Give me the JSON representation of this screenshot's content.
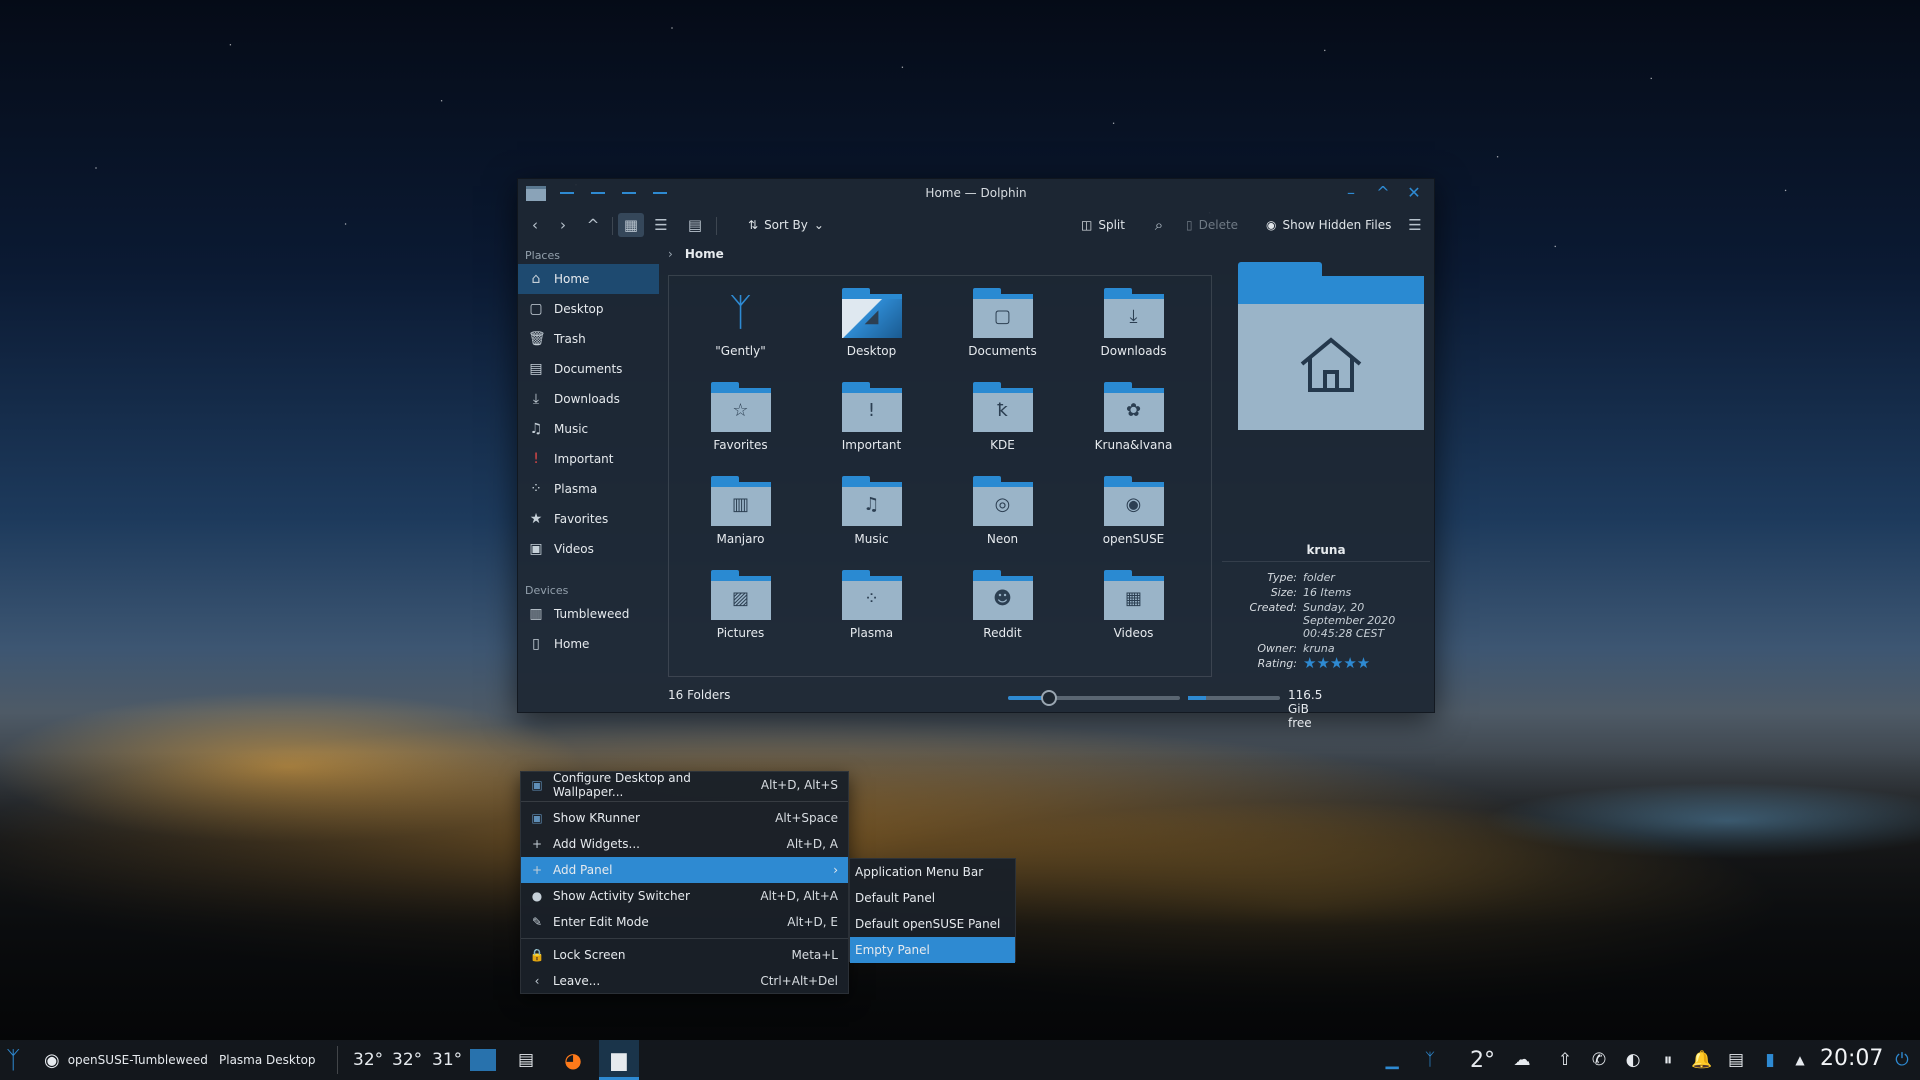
{
  "window": {
    "title": "Home — Dolphin",
    "toolbar": {
      "sort_by": "Sort By",
      "split": "Split",
      "delete": "Delete",
      "show_hidden": "Show Hidden Files"
    },
    "breadcrumb": "Home"
  },
  "places": {
    "places_header": "Places",
    "items": [
      {
        "label": "Home",
        "icon": "home-icon",
        "glyph": "⌂"
      },
      {
        "label": "Desktop",
        "icon": "desktop-icon",
        "glyph": "▢"
      },
      {
        "label": "Trash",
        "icon": "trash-icon",
        "glyph": "🗑"
      },
      {
        "label": "Documents",
        "icon": "documents-icon",
        "glyph": "▤"
      },
      {
        "label": "Downloads",
        "icon": "download-icon",
        "glyph": "⤓"
      },
      {
        "label": "Music",
        "icon": "music-icon",
        "glyph": "♫"
      },
      {
        "label": "Important",
        "icon": "exclamation-icon",
        "glyph": "!"
      },
      {
        "label": "Plasma",
        "icon": "plasma-icon",
        "glyph": "⁘"
      },
      {
        "label": "Favorites",
        "icon": "star-icon",
        "glyph": "★"
      },
      {
        "label": "Videos",
        "icon": "video-icon",
        "glyph": "▣"
      }
    ],
    "devices_header": "Devices",
    "devices": [
      {
        "label": "Tumbleweed",
        "icon": "drive-icon",
        "glyph": "▥"
      },
      {
        "label": "Home",
        "icon": "drive-icon",
        "glyph": "▯"
      }
    ]
  },
  "folders": [
    {
      "label": "\"Gently\"",
      "emblem": "gently-logo-icon",
      "glyph": "ᛉ"
    },
    {
      "label": "Desktop",
      "emblem": "desktop-thumbnail-icon",
      "glyph": "◢"
    },
    {
      "label": "Documents",
      "emblem": "document-icon",
      "glyph": "▢"
    },
    {
      "label": "Downloads",
      "emblem": "download-icon",
      "glyph": "⤓"
    },
    {
      "label": "Favorites",
      "emblem": "star-icon",
      "glyph": "☆"
    },
    {
      "label": "Important",
      "emblem": "exclamation-icon",
      "glyph": "!"
    },
    {
      "label": "KDE",
      "emblem": "kde-icon",
      "glyph": "ꝁ"
    },
    {
      "label": "Kruna&Ivana",
      "emblem": "photo-icon",
      "glyph": "✿"
    },
    {
      "label": "Manjaro",
      "emblem": "manjaro-icon",
      "glyph": "▥"
    },
    {
      "label": "Music",
      "emblem": "music-icon",
      "glyph": "♫"
    },
    {
      "label": "Neon",
      "emblem": "neon-icon",
      "glyph": "◎"
    },
    {
      "label": "openSUSE",
      "emblem": "opensuse-icon",
      "glyph": "◉"
    },
    {
      "label": "Pictures",
      "emblem": "picture-icon",
      "glyph": "▨"
    },
    {
      "label": "Plasma",
      "emblem": "plasma-icon",
      "glyph": "⁘"
    },
    {
      "label": "Reddit",
      "emblem": "reddit-icon",
      "glyph": "☻"
    },
    {
      "label": "Videos",
      "emblem": "film-icon",
      "glyph": "▦"
    }
  ],
  "info": {
    "name": "kruna",
    "type_label": "Type:",
    "type": "folder",
    "size_label": "Size:",
    "size": "16 Items",
    "created_label": "Created:",
    "created": "Sunday, 20 September 2020 00:45:28 CEST",
    "owner_label": "Owner:",
    "owner": "kruna",
    "rating_label": "Rating:",
    "rating": "★★★★★",
    "rating_value": 5
  },
  "status": {
    "count": "16 Folders",
    "free": "116.5 GiB free",
    "zoom_fraction": 0.24,
    "used_fraction": 0.2
  },
  "menu": {
    "items": [
      {
        "label": "Configure Desktop and Wallpaper...",
        "shortcut": "Alt+D, Alt+S",
        "icon": "configure-icon",
        "glyph": "▣"
      },
      {
        "label": "Show KRunner",
        "shortcut": "Alt+Space",
        "icon": "krunner-icon",
        "glyph": "▣"
      },
      {
        "label": "Add Widgets...",
        "shortcut": "Alt+D, A",
        "icon": "plus-icon",
        "glyph": "+"
      },
      {
        "label": "Add Panel",
        "shortcut": "",
        "icon": "plus-icon",
        "glyph": "+"
      },
      {
        "label": "Show Activity Switcher",
        "shortcut": "Alt+D, Alt+A",
        "icon": "activities-icon",
        "glyph": "●"
      },
      {
        "label": "Enter Edit Mode",
        "shortcut": "Alt+D, E",
        "icon": "pencil-icon",
        "glyph": "✎"
      },
      {
        "label": "Lock Screen",
        "shortcut": "Meta+L",
        "icon": "lock-icon",
        "glyph": "🔒"
      },
      {
        "label": "Leave...",
        "shortcut": "Ctrl+Alt+Del",
        "icon": "chevron-left-icon",
        "glyph": "‹"
      }
    ],
    "submenu": [
      "Application Menu Bar",
      "Default Panel",
      "Default openSUSE Panel",
      "Empty Panel"
    ]
  },
  "taskbar": {
    "activity": "openSUSE-Tumbleweed",
    "desktop": "Plasma Desktop",
    "temps": [
      "32°",
      "32°",
      "31°"
    ],
    "weather": "2°",
    "time": "20:07"
  },
  "colors": {
    "accent": "#2e8ad2",
    "selection": "#1e4a70"
  }
}
